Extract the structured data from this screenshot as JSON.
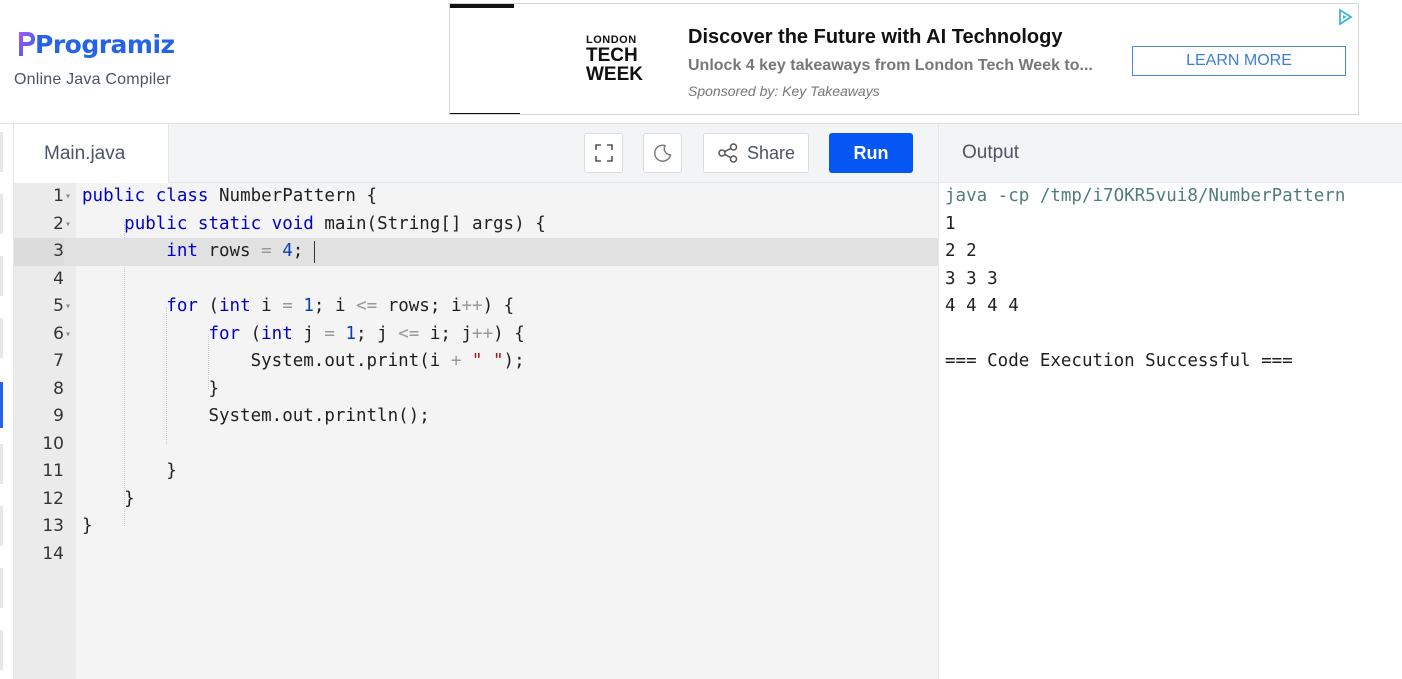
{
  "header": {
    "brand": "Programiz",
    "subtitle": "Online Java Compiler"
  },
  "ad": {
    "logo_line1": "LONDON",
    "logo_line2": "TECH",
    "logo_line3": "WEEK",
    "title": "Discover the Future with AI Technology",
    "description": "Unlock 4 key takeaways from London Tech Week to...",
    "sponsor": "Sponsored by: Key Takeaways",
    "button_label": "LEARN MORE"
  },
  "editor": {
    "file_name": "Main.java",
    "share_label": "Share",
    "run_label": "Run",
    "lines": [
      {
        "n": "1",
        "fold": true,
        "text": "public class NumberPattern {"
      },
      {
        "n": "2",
        "fold": true,
        "text": "    public static void main(String[] args) {"
      },
      {
        "n": "3",
        "fold": false,
        "text": "        int rows = 4;"
      },
      {
        "n": "4",
        "fold": false,
        "text": ""
      },
      {
        "n": "5",
        "fold": true,
        "text": "        for (int i = 1; i <= rows; i++) {"
      },
      {
        "n": "6",
        "fold": true,
        "text": "            for (int j = 1; j <= i; j++) {"
      },
      {
        "n": "7",
        "fold": false,
        "text": "                System.out.print(i + \" \");"
      },
      {
        "n": "8",
        "fold": false,
        "text": "            }"
      },
      {
        "n": "9",
        "fold": false,
        "text": "            System.out.println();"
      },
      {
        "n": "10",
        "fold": false,
        "text": ""
      },
      {
        "n": "11",
        "fold": false,
        "text": "        }"
      },
      {
        "n": "12",
        "fold": false,
        "text": "    }"
      },
      {
        "n": "13",
        "fold": false,
        "text": "}"
      },
      {
        "n": "14",
        "fold": false,
        "text": ""
      }
    ]
  },
  "output": {
    "title": "Output",
    "lines": [
      "java -cp /tmp/i7OKR5vui8/NumberPattern",
      "1",
      "2 2",
      "3 3 3",
      "4 4 4 4",
      "",
      "=== Code Execution Successful ==="
    ]
  },
  "colors": {
    "brand": "#2563eb",
    "run_button": "#0556f3",
    "keyword": "#0000cc",
    "number": "#0a3fb5",
    "output_command": "#4e7d7a"
  }
}
